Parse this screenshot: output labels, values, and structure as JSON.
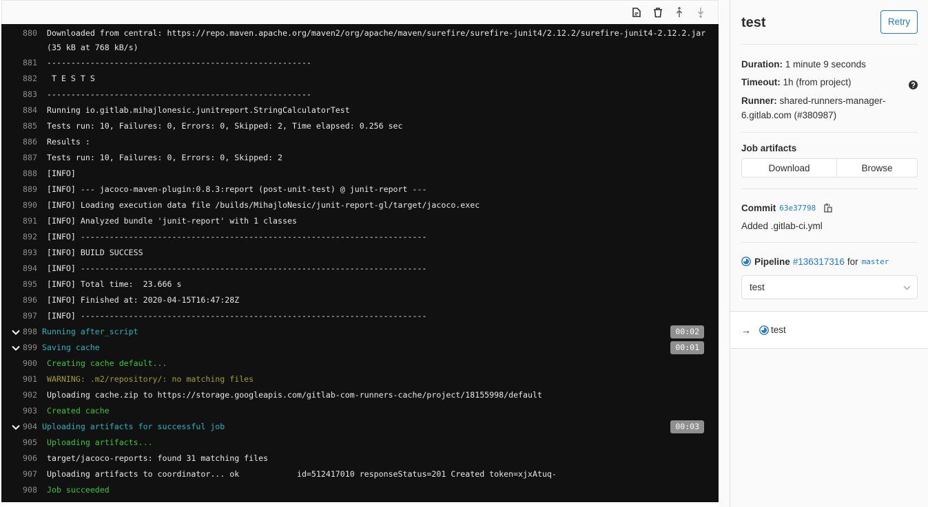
{
  "toolbar": {
    "icons": [
      "raw-log-icon",
      "erase-log-icon",
      "scroll-to-top-icon",
      "scroll-to-bottom-icon"
    ]
  },
  "log": {
    "lines": [
      {
        "num": "880",
        "text": "Downloaded from central: https://repo.maven.apache.org/maven2/org/apache/maven/surefire/surefire-junit4/2.12.2/surefire-junit4-2.12.2.jar (35 kB at 768 kB/s)",
        "style": "normal"
      },
      {
        "num": "881",
        "text": "-------------------------------------------------------",
        "style": "normal"
      },
      {
        "num": "882",
        "text": " T E S T S",
        "style": "normal"
      },
      {
        "num": "883",
        "text": "-------------------------------------------------------",
        "style": "normal"
      },
      {
        "num": "884",
        "text": "Running io.gitlab.mihajlonesic.junitreport.StringCalculatorTest",
        "style": "normal"
      },
      {
        "num": "885",
        "text": "Tests run: 10, Failures: 0, Errors: 0, Skipped: 2, Time elapsed: 0.256 sec",
        "style": "normal"
      },
      {
        "num": "886",
        "text": "Results :",
        "style": "normal"
      },
      {
        "num": "887",
        "text": "Tests run: 10, Failures: 0, Errors: 0, Skipped: 2",
        "style": "normal"
      },
      {
        "num": "888",
        "text": "[INFO]",
        "style": "normal"
      },
      {
        "num": "889",
        "text": "[INFO] --- jacoco-maven-plugin:0.8.3:report (post-unit-test) @ junit-report ---",
        "style": "normal"
      },
      {
        "num": "890",
        "text": "[INFO] Loading execution data file /builds/MihajloNesic/junit-report-gl/target/jacoco.exec",
        "style": "normal"
      },
      {
        "num": "891",
        "text": "[INFO] Analyzed bundle 'junit-report' with 1 classes",
        "style": "normal"
      },
      {
        "num": "892",
        "text": "[INFO] ------------------------------------------------------------------------",
        "style": "normal"
      },
      {
        "num": "893",
        "text": "[INFO] BUILD SUCCESS",
        "style": "normal"
      },
      {
        "num": "894",
        "text": "[INFO] ------------------------------------------------------------------------",
        "style": "normal"
      },
      {
        "num": "895",
        "text": "[INFO] Total time:  23.666 s",
        "style": "normal"
      },
      {
        "num": "896",
        "text": "[INFO] Finished at: 2020-04-15T16:47:28Z",
        "style": "normal"
      },
      {
        "num": "897",
        "text": "[INFO] ------------------------------------------------------------------------",
        "style": "normal"
      },
      {
        "num": "898",
        "text": "Running after_script",
        "style": "section",
        "duration": "00:02"
      },
      {
        "num": "899",
        "text": "Saving cache",
        "style": "section",
        "duration": "00:01"
      },
      {
        "num": "900",
        "text": "Creating cache default...",
        "style": "green"
      },
      {
        "num": "901",
        "text": "WARNING: .m2/repository/: no matching files",
        "style": "warn"
      },
      {
        "num": "902",
        "text": "Uploading cache.zip to https://storage.googleapis.com/gitlab-com-runners-cache/project/18155998/default",
        "style": "normal"
      },
      {
        "num": "903",
        "text": "Created cache",
        "style": "green"
      },
      {
        "num": "904",
        "text": "Uploading artifacts for successful job",
        "style": "section",
        "duration": "00:03"
      },
      {
        "num": "905",
        "text": "Uploading artifacts...",
        "style": "green"
      },
      {
        "num": "906",
        "text": "target/jacoco-reports: found 31 matching files",
        "style": "normal"
      },
      {
        "num": "907",
        "text": "Uploading artifacts to coordinator... ok            id=512417010 responseStatus=201 Created token=xjxAtuq-",
        "style": "normal"
      },
      {
        "num": "908",
        "text": "Job succeeded",
        "style": "green"
      }
    ]
  },
  "sidebar": {
    "job_name": "test",
    "retry_label": "Retry",
    "duration_label": "Duration:",
    "duration_value": "1 minute 9 seconds",
    "timeout_label": "Timeout:",
    "timeout_value": "1h (from project)",
    "runner_label": "Runner:",
    "runner_value": "shared-runners-manager-6.gitlab.com (#380987)",
    "artifacts_title": "Job artifacts",
    "download_label": "Download",
    "browse_label": "Browse",
    "commit_label": "Commit",
    "commit_sha": "63e37798",
    "commit_message": "Added .gitlab-ci.yml",
    "pipeline_label": "Pipeline",
    "pipeline_id": "#136317316",
    "for_text": "for",
    "branch": "master",
    "stage_selected": "test",
    "jobs": [
      {
        "arrow": "→",
        "name": "test",
        "status": "running"
      }
    ]
  },
  "colors": {
    "accent": "#1f78d1",
    "log_bg": "#111111",
    "section": "#26b3bc",
    "success": "#3ac43a",
    "warning": "#a39d33",
    "badge": "#8f8f8f"
  }
}
